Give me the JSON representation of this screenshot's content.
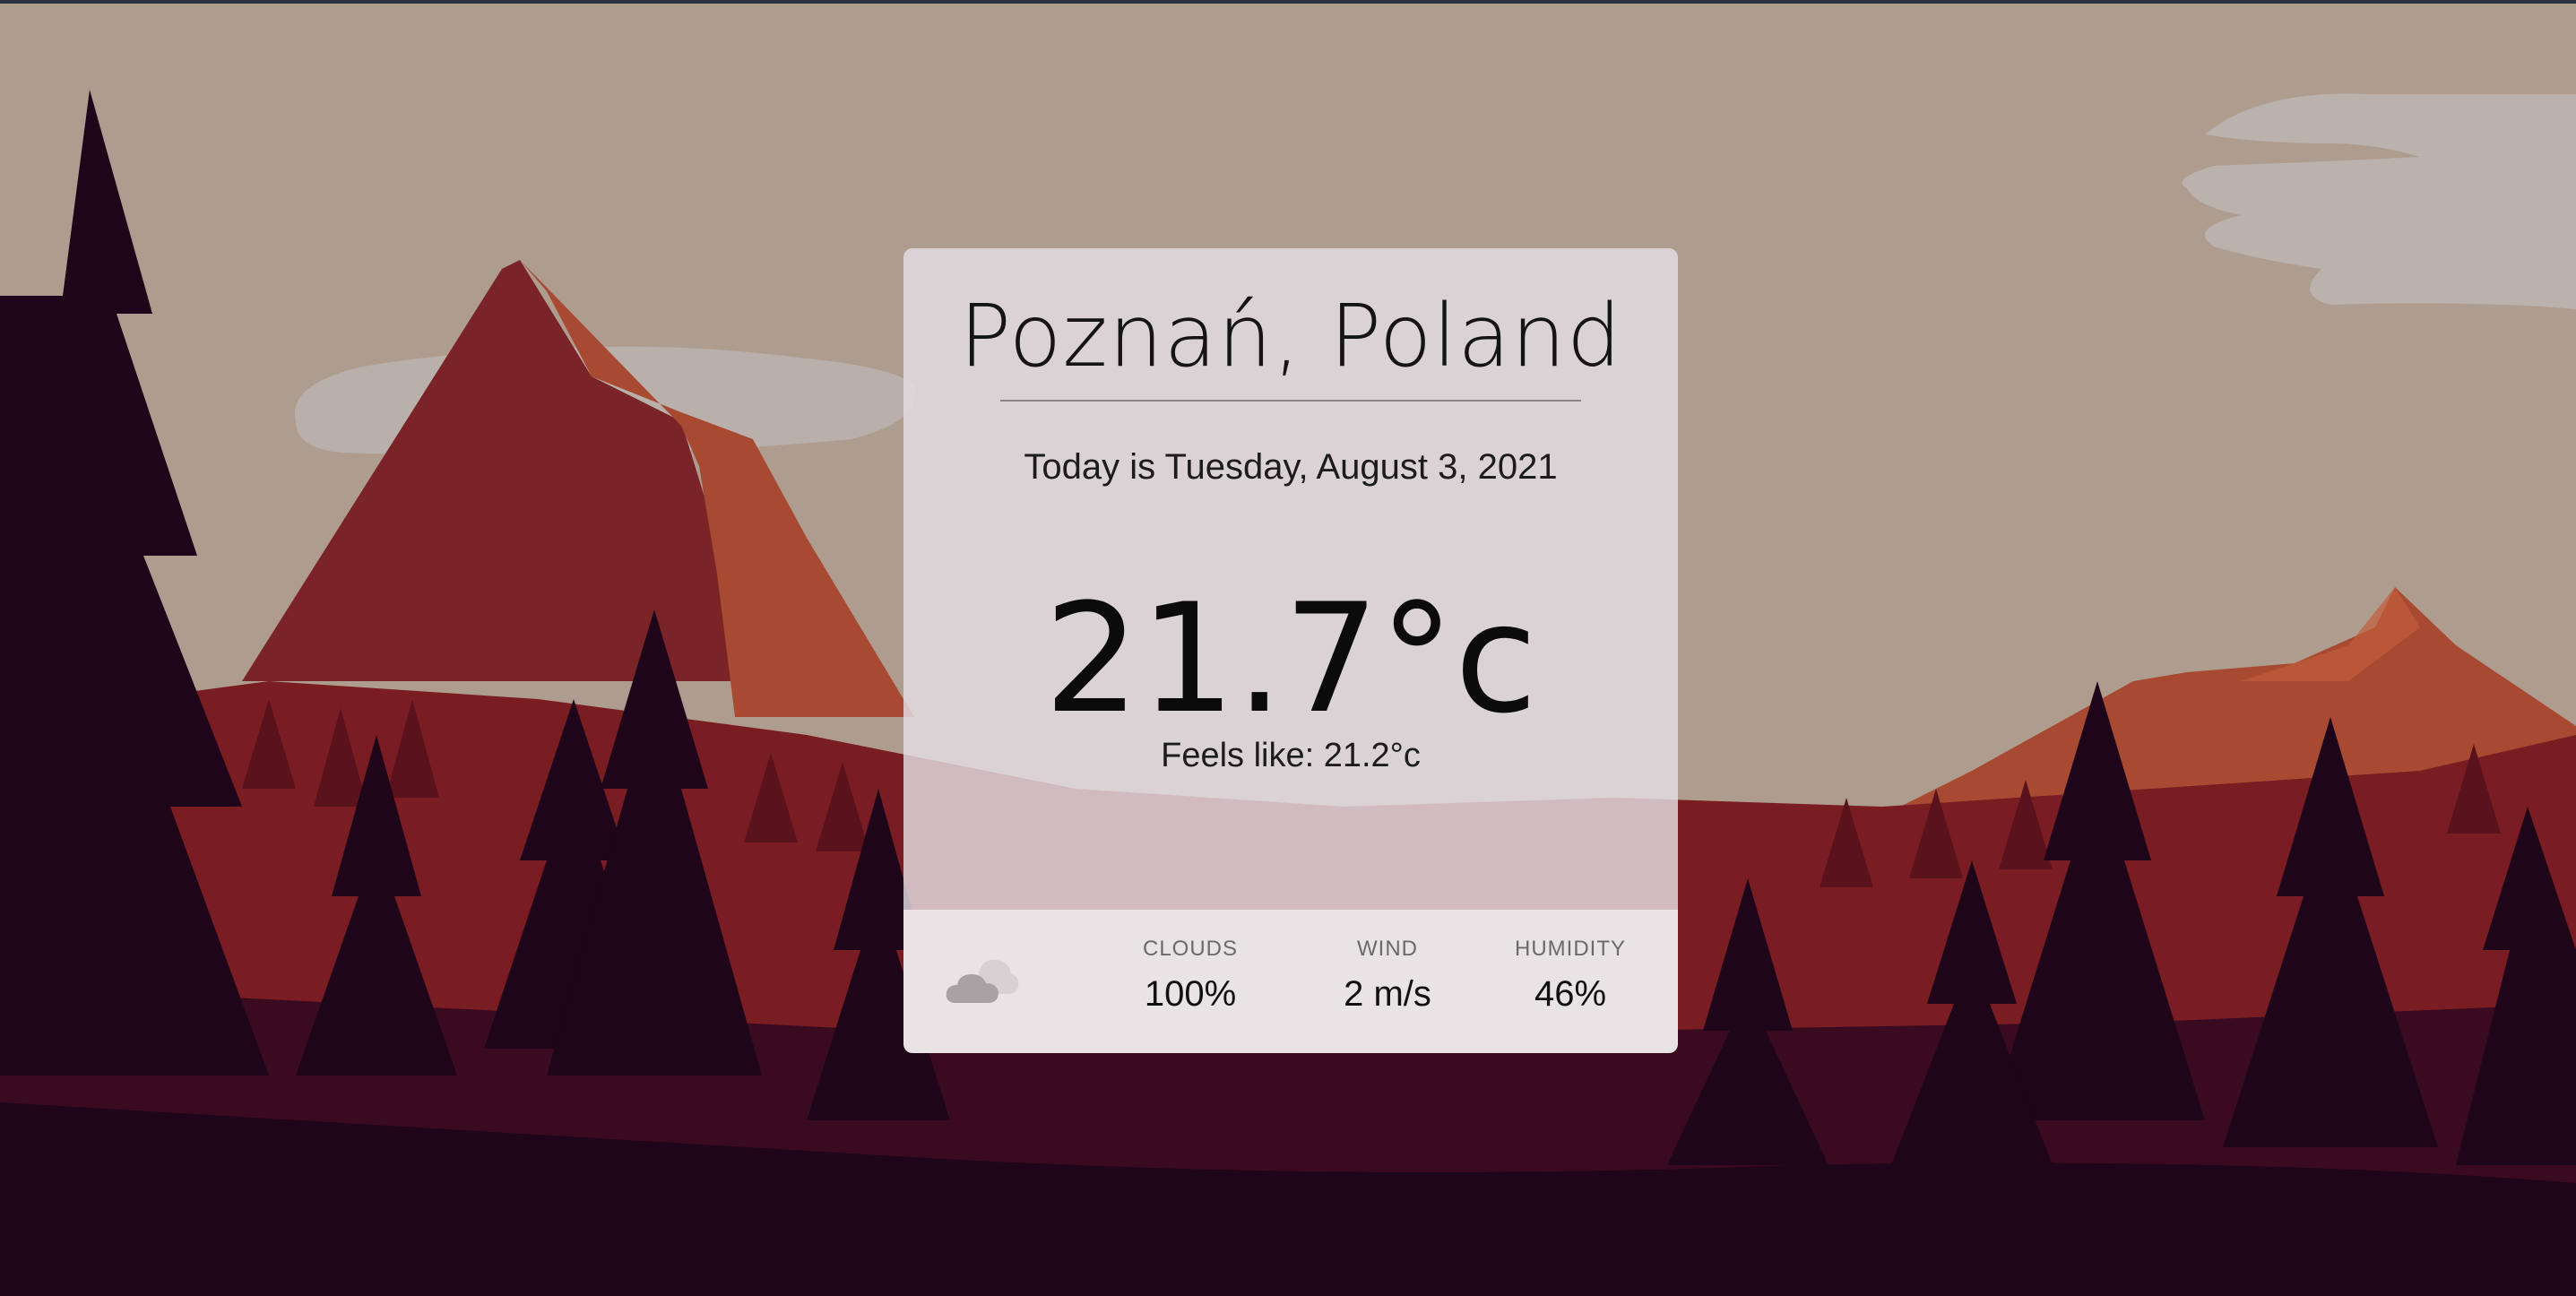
{
  "weather": {
    "location": "Poznań, Poland",
    "date_text": "Today is Tuesday, August 3, 2021",
    "temperature": "21.7°c",
    "feels_like": "Feels like: 21.2°c",
    "condition_icon": "cloud-icon",
    "stats": {
      "clouds": {
        "label": "CLOUDS",
        "value": "100%"
      },
      "wind": {
        "label": "WIND",
        "value": "2 m/s"
      },
      "humidity": {
        "label": "HUMIDITY",
        "value": "46%"
      }
    }
  },
  "colors": {
    "sky": "#ae9c8f",
    "mountain": "#a84a32",
    "forest": "#1e0519"
  }
}
